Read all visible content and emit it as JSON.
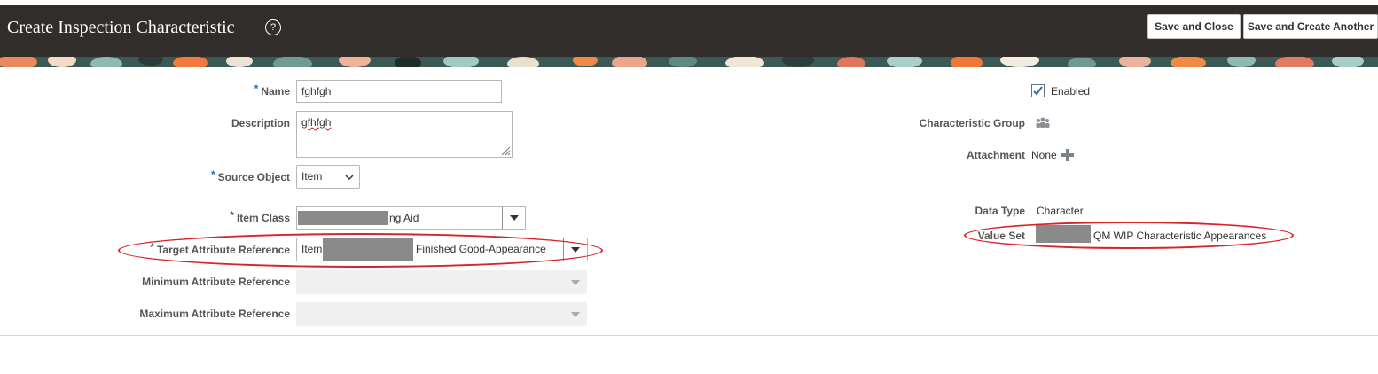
{
  "header": {
    "title": "Create Inspection Characteristic",
    "help_glyph": "?",
    "save_close_label": "Save and Close",
    "save_create_label": "Save and Create Another"
  },
  "form": {
    "required_marker": "*",
    "name": {
      "label": "Name",
      "value": "fghfgh"
    },
    "description": {
      "label": "Description",
      "value": "gfhfgh"
    },
    "source_object": {
      "label": "Source Object",
      "value": "Item"
    },
    "item_class": {
      "label": "Item Class",
      "value": "ng Aid"
    },
    "target_attr": {
      "label": "Target Attribute Reference",
      "value_prefix": "Item",
      "value_suffix": "Finished Good-Appearance"
    },
    "min_attr": {
      "label": "Minimum Attribute Reference"
    },
    "max_attr": {
      "label": "Maximum Attribute Reference"
    }
  },
  "right": {
    "enabled_label": "Enabled",
    "enabled_checked": true,
    "char_group_label": "Characteristic Group",
    "attachment_label": "Attachment",
    "attachment_value": "None",
    "data_type_label": "Data Type",
    "data_type_value": "Character",
    "value_set_label": "Value Set",
    "value_set_value": "QM WIP Characteristic Appearances"
  },
  "colors": {
    "header_bg": "#312d2a",
    "accent": "#2f6ea0",
    "annotation": "#d8232a"
  },
  "icons": [
    "help-icon",
    "chevron-down-icon",
    "checkbox-check-icon",
    "group-icon",
    "plus-icon",
    "resize-grip-icon"
  ]
}
